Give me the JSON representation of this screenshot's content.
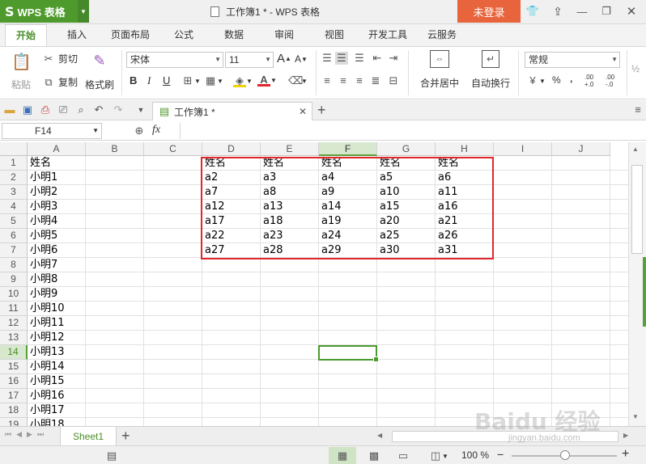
{
  "app": {
    "name": "WPS 表格",
    "window_title": "工作簿1 * - WPS 表格",
    "login_label": "未登录"
  },
  "menu": {
    "tabs": [
      "开始",
      "插入",
      "页面布局",
      "公式",
      "数据",
      "审阅",
      "视图",
      "开发工具",
      "云服务"
    ],
    "active": "开始"
  },
  "ribbon": {
    "paste": "粘贴",
    "cut": "剪切",
    "copy": "复制",
    "format_painter": "格式刷",
    "font_name": "宋体",
    "font_size": "11",
    "bold": "B",
    "italic": "I",
    "underline": "U",
    "merge_center": "合并居中",
    "wrap_text": "自动换行",
    "number_format": "常规",
    "percent": "%",
    "comma": "‚",
    "inc_decimal": ".00 +.0",
    "dec_decimal": ".00 -.0"
  },
  "doc_tab": {
    "label": "工作簿1 *"
  },
  "formula": {
    "cell_ref": "F14",
    "fx": "fx",
    "value": ""
  },
  "sheet": {
    "columns": [
      "A",
      "B",
      "C",
      "D",
      "E",
      "F",
      "G",
      "H",
      "I",
      "J"
    ],
    "selected_column": "F",
    "selected_row": 14,
    "rows": [
      {
        "n": "1",
        "A": "姓名",
        "D": "姓名",
        "E": "姓名",
        "F": "姓名",
        "G": "姓名",
        "H": "姓名"
      },
      {
        "n": "2",
        "A": "小明1",
        "D": "a2",
        "E": "a3",
        "F": "a4",
        "G": "a5",
        "H": "a6"
      },
      {
        "n": "3",
        "A": "小明2",
        "D": "a7",
        "E": "a8",
        "F": "a9",
        "G": "a10",
        "H": "a11"
      },
      {
        "n": "4",
        "A": "小明3",
        "D": "a12",
        "E": "a13",
        "F": "a14",
        "G": "a15",
        "H": "a16"
      },
      {
        "n": "5",
        "A": "小明4",
        "D": "a17",
        "E": "a18",
        "F": "a19",
        "G": "a20",
        "H": "a21"
      },
      {
        "n": "6",
        "A": "小明5",
        "D": "a22",
        "E": "a23",
        "F": "a24",
        "G": "a25",
        "H": "a26"
      },
      {
        "n": "7",
        "A": "小明6",
        "D": "a27",
        "E": "a28",
        "F": "a29",
        "G": "a30",
        "H": "a31"
      },
      {
        "n": "8",
        "A": "小明7"
      },
      {
        "n": "9",
        "A": "小明8"
      },
      {
        "n": "10",
        "A": "小明9"
      },
      {
        "n": "11",
        "A": "小明10"
      },
      {
        "n": "12",
        "A": "小明11"
      },
      {
        "n": "13",
        "A": "小明12"
      },
      {
        "n": "14",
        "A": "小明13"
      },
      {
        "n": "15",
        "A": "小明14"
      },
      {
        "n": "16",
        "A": "小明15"
      },
      {
        "n": "17",
        "A": "小明16"
      },
      {
        "n": "18",
        "A": "小明17"
      },
      {
        "n": "19",
        "A": "小明18"
      }
    ]
  },
  "sheet_tabs": {
    "active": "Sheet1",
    "add": "+"
  },
  "status": {
    "zoom": "100 %",
    "zoom_out": "−",
    "zoom_in": "+"
  },
  "watermark": {
    "brand": "Baidu 经验",
    "url": "jingyan.baidu.com"
  },
  "colors": {
    "accent": "#4e9a2d",
    "login": "#e8643c",
    "highlight_box": "#e0272c"
  }
}
